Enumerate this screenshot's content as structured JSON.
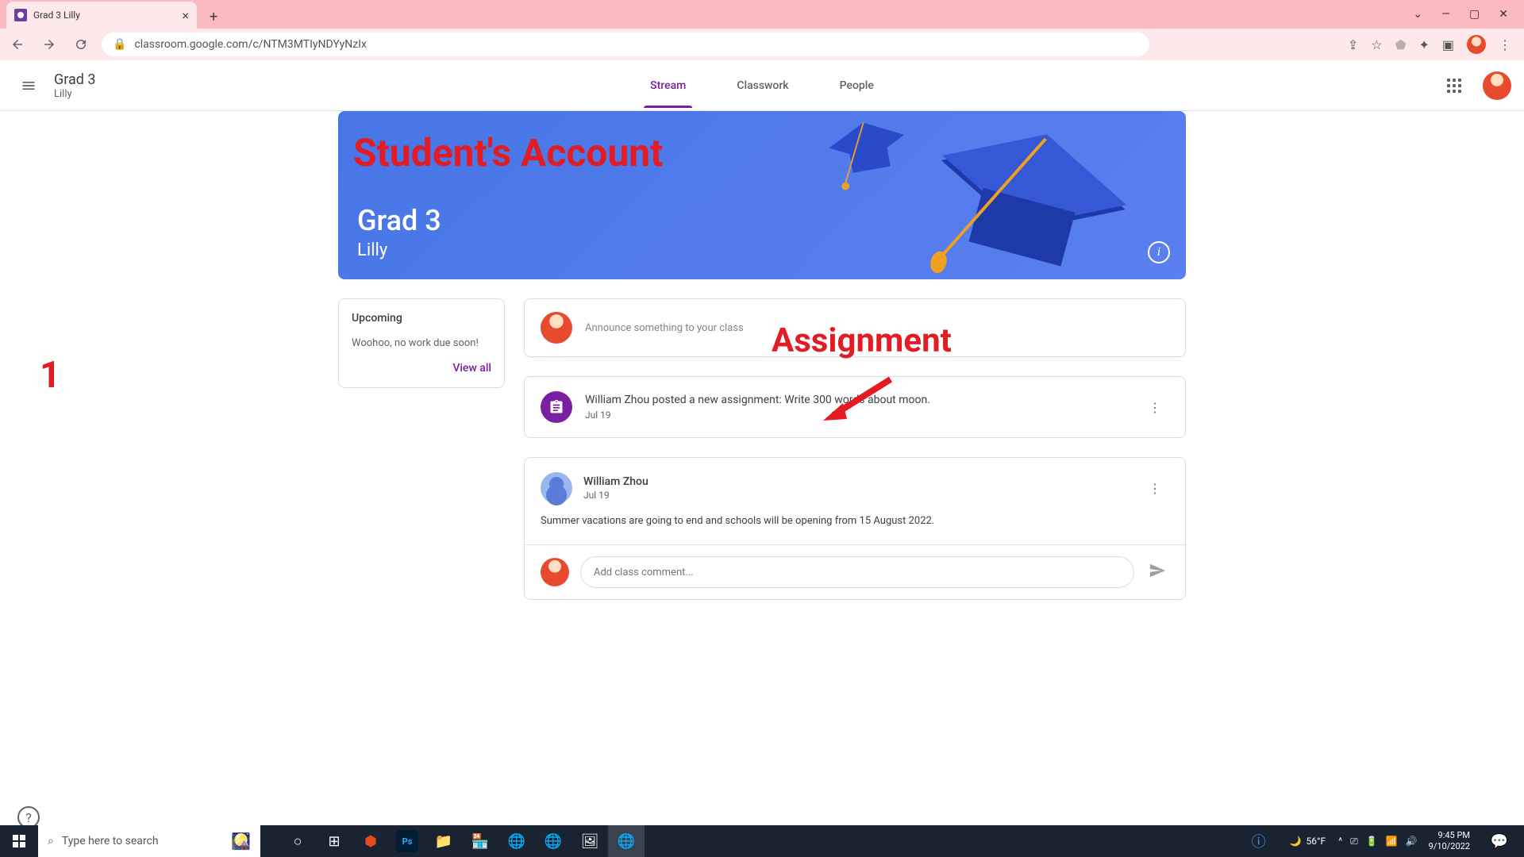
{
  "browser": {
    "tab_title": "Grad 3 Lilly",
    "url": "classroom.google.com/c/NTM3MTIyNDYyNzIx"
  },
  "header": {
    "class_name": "Grad 3",
    "section": "Lilly",
    "tabs": {
      "stream": "Stream",
      "classwork": "Classwork",
      "people": "People"
    }
  },
  "banner": {
    "title": "Grad 3",
    "section": "Lilly"
  },
  "upcoming": {
    "title": "Upcoming",
    "message": "Woohoo, no work due soon!",
    "view_all": "View all"
  },
  "announce": {
    "placeholder": "Announce something to your class"
  },
  "assignment_post": {
    "title": "William Zhou posted a new assignment: Write 300 words about moon.",
    "date": "Jul 19"
  },
  "announcement_post": {
    "author": "William Zhou",
    "date": "Jul 19",
    "content": "Summer vacations are going to end and schools will be opening from 15 August 2022.",
    "comment_placeholder": "Add class comment..."
  },
  "annotations": {
    "title": "Student's Account",
    "label": "Assignment",
    "number": "1"
  },
  "taskbar": {
    "search_placeholder": "Type here to search",
    "weather": "56°F",
    "time": "9:45 PM",
    "date": "9/10/2022"
  }
}
